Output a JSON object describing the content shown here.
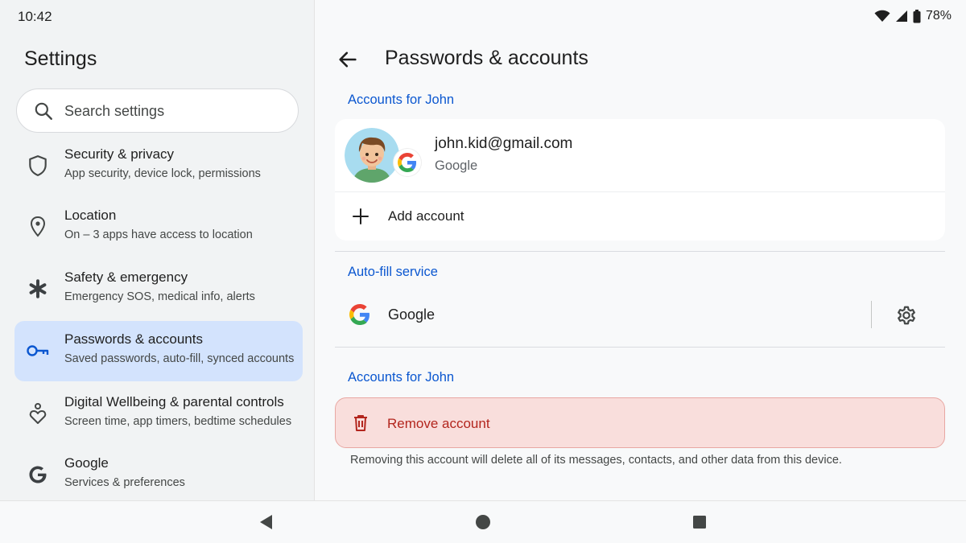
{
  "status_bar": {
    "time": "10:42",
    "battery": "78%"
  },
  "sidebar": {
    "title": "Settings",
    "search_placeholder": "Search settings",
    "items": [
      {
        "icon": "shield-icon",
        "title": "Security & privacy",
        "subtitle": "App security, device lock, permissions",
        "active": false
      },
      {
        "icon": "location-pin-icon",
        "title": "Location",
        "subtitle": "On – 3 apps have access to location",
        "active": false
      },
      {
        "icon": "asterisk-icon",
        "title": "Safety & emergency",
        "subtitle": "Emergency SOS, medical info, alerts",
        "active": false
      },
      {
        "icon": "key-icon",
        "title": "Passwords & accounts",
        "subtitle": "Saved passwords, auto-fill, synced accounts",
        "active": true
      },
      {
        "icon": "wellbeing-icon",
        "title": "Digital Wellbeing & parental controls",
        "subtitle": "Screen time, app timers, bedtime schedules",
        "active": false
      },
      {
        "icon": "google-g-icon",
        "title": "Google",
        "subtitle": "Services & preferences",
        "active": false
      }
    ]
  },
  "main": {
    "title": "Passwords & accounts",
    "accounts_section_label": "Accounts for John",
    "account": {
      "email": "john.kid@gmail.com",
      "type": "Google"
    },
    "add_account_label": "Add account",
    "autofill_section_label": "Auto-fill service",
    "autofill_service": "Google",
    "remove_section_label": "Accounts for John",
    "remove_account_label": "Remove account",
    "remove_warning": "Removing this account will delete all of its messages, contacts, and other data from this device."
  },
  "colors": {
    "accent": "#0b57d0",
    "active_bg": "#d3e3fd",
    "danger": "#b3261e",
    "danger_bg": "#f9dedc"
  }
}
